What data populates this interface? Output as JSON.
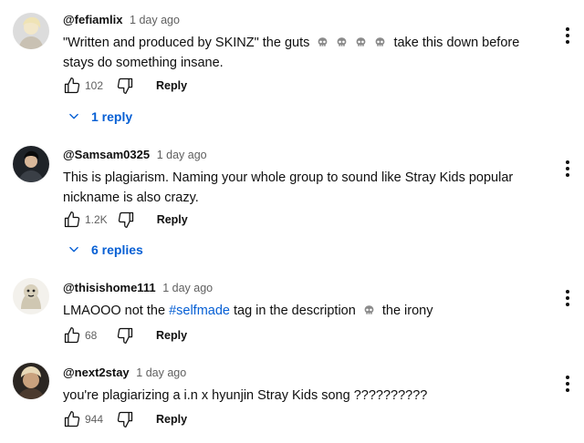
{
  "comments": [
    {
      "handle": "@fefiamlix",
      "time": "1 day ago",
      "text_a": "\"Written and produced by SKINZ\" the guts",
      "text_b": "take this down before stays do something insane.",
      "likes": "102",
      "reply_label": "Reply",
      "replies_label": "1 reply"
    },
    {
      "handle": "@Samsam0325",
      "time": "1 day ago",
      "text": "This is plagiarism. Naming your whole group to sound like Stray Kids popular nickname is also crazy.",
      "likes": "1.2K",
      "reply_label": "Reply",
      "replies_label": "6 replies"
    },
    {
      "handle": "@thisishome111",
      "time": "1 day ago",
      "text_a": "LMAOOO not the",
      "hashtag": "#selfmade",
      "text_b": "tag in the description",
      "text_c": "the irony",
      "likes": "68",
      "reply_label": "Reply"
    },
    {
      "handle": "@next2stay",
      "time": "1 day ago",
      "text": "you're plagiarizing a i.n x hyunjin Stray Kids song ??????????",
      "likes": "944",
      "reply_label": "Reply"
    }
  ],
  "icons": {
    "like": "thumbs-up-icon",
    "dislike": "thumbs-down-icon",
    "more": "more-vertical-icon",
    "expand": "chevron-down-icon",
    "emoji": "skull-emoji-icon"
  },
  "colors": {
    "link": "#065fd4",
    "secondary_text": "#606060",
    "primary_text": "#0f0f0f"
  }
}
